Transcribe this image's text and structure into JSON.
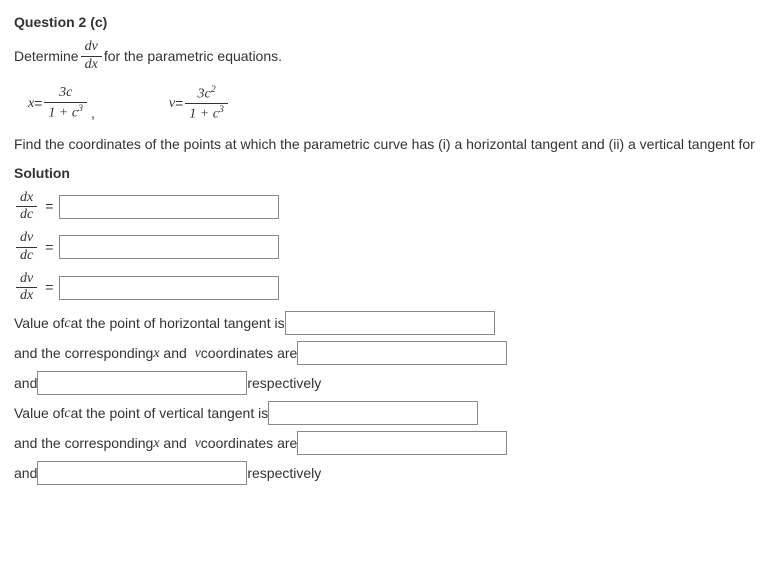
{
  "title": "Question 2 (c)",
  "intro": {
    "pre": "Determine ",
    "frac_num": "dv",
    "frac_den": "dx",
    "post": " for the parametric equations."
  },
  "eq": {
    "x_lhs": "x",
    "x_eq": " = ",
    "x_num": "3c",
    "x_den_pre": "1 + c",
    "x_den_sup": "3",
    "comma": ",",
    "v_lhs": "v",
    "v_eq": " = ",
    "v_num_pre": "3c",
    "v_num_sup": "2",
    "v_den_pre": "1 + c",
    "v_den_sup": "3"
  },
  "instr": "Find the coordinates of the points at which the  parametric curve has (i) a horizontal tangent and (ii) a vertical tangent for",
  "solution_label": "Solution",
  "deriv": {
    "dxdc_num": "dx",
    "dxdc_den": "dc",
    "dvdc_num": "dv",
    "dvdc_den": "dc",
    "dvdx_num": "dv",
    "dvdx_den": "dx",
    "eq": "="
  },
  "lines": {
    "h1_pre": "Value of ",
    "c": "c",
    "h1_post": " at the point of horizontal tangent is ",
    "h2_pre": "and the corresponding ",
    "x": "x",
    "and_word": " and  ",
    "v": "v",
    "h2_post": " coordinates are ",
    "and": "and ",
    "resp": " respectively",
    "v1_post": " at the point of vertical tangent is "
  }
}
